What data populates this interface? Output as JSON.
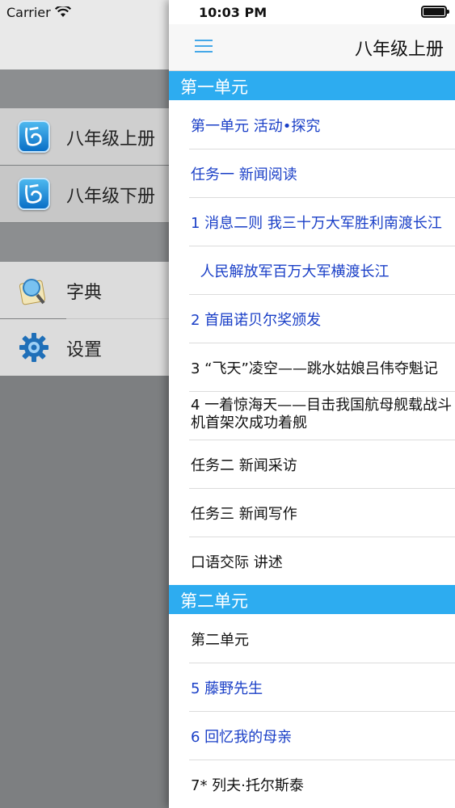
{
  "status": {
    "carrier": "Carrier",
    "time": "10:03 PM"
  },
  "side_menu": {
    "items": [
      {
        "label": "八年级上册",
        "icon": "book-app-icon"
      },
      {
        "label": "八年级下册",
        "icon": "book-app-icon"
      },
      {
        "label": "字典",
        "icon": "dictionary-icon"
      },
      {
        "label": "设置",
        "icon": "gear-icon"
      }
    ]
  },
  "header": {
    "title": "八年级上册"
  },
  "sections": [
    {
      "title": "第一单元",
      "items": [
        {
          "text": "第一单元 活动•探究",
          "color": "blue"
        },
        {
          "text": "任务一 新闻阅读",
          "color": "blue"
        },
        {
          "text": "1 消息二则  我三十万大军胜利南渡长江",
          "color": "blue"
        },
        {
          "text": "  人民解放军百万大军横渡长江",
          "color": "blue"
        },
        {
          "text": "2 首届诺贝尔奖颁发",
          "color": "blue"
        },
        {
          "text": "3 “飞天”凌空——跳水姑娘吕伟夺魁记",
          "color": "black"
        },
        {
          "text": "4 一着惊海天——目击我国航母舰载战斗机首架次成功着舰",
          "color": "black"
        },
        {
          "text": "任务二 新闻采访",
          "color": "black"
        },
        {
          "text": "任务三 新闻写作",
          "color": "black"
        },
        {
          "text": "口语交际 讲述",
          "color": "black"
        }
      ]
    },
    {
      "title": "第二单元",
      "items": [
        {
          "text": "第二单元",
          "color": "black"
        },
        {
          "text": "5 藤野先生",
          "color": "blue"
        },
        {
          "text": "6 回忆我的母亲",
          "color": "blue"
        },
        {
          "text": "7* 列夫·托尔斯泰",
          "color": "black"
        }
      ]
    }
  ],
  "colors": {
    "accent": "#2dacf0",
    "link_blue": "#1a3fc7"
  }
}
